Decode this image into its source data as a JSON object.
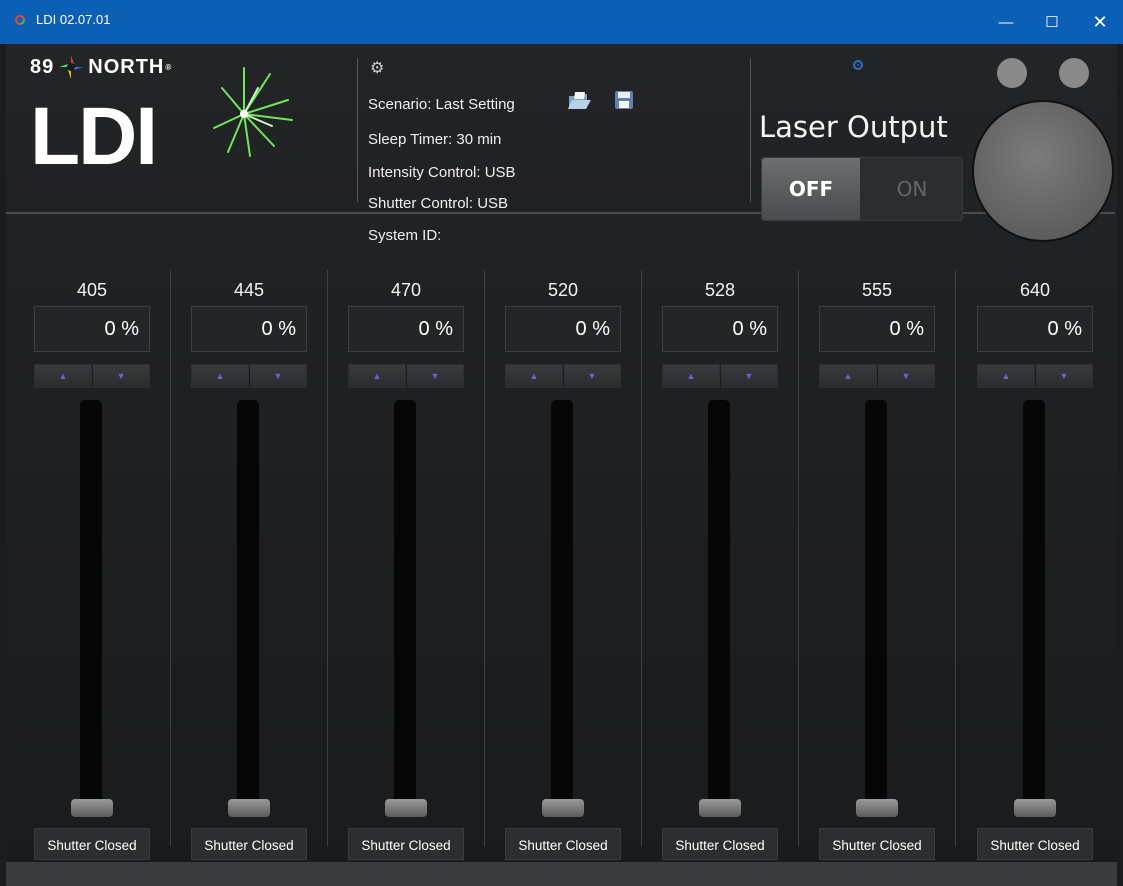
{
  "window": {
    "title": "LDI 02.07.01",
    "minimize_glyph": "—",
    "maximize_glyph": "☐",
    "close_glyph": "✕"
  },
  "logo": {
    "brand_top_left": "89",
    "brand_top_right": "NORTH",
    "trademark": "®",
    "product": "LDI"
  },
  "settings": {
    "gear_icon": "gear-icon",
    "scenario_label": "Scenario:",
    "scenario_value": "Last Setting",
    "sleep_timer": "Sleep Timer: 30 min",
    "intensity_control": "Intensity Control: USB",
    "shutter_control": "Shutter Control: USB",
    "system_id": "System ID:",
    "open_icon": "folder-open-icon",
    "save_icon": "save-disk-icon"
  },
  "laser": {
    "title": "Laser Output",
    "off_label": "OFF",
    "on_label": "ON",
    "state": "OFF"
  },
  "channels": [
    {
      "wavelength": "405",
      "intensity": "0 %",
      "shutter": "Shutter Closed",
      "level": 0
    },
    {
      "wavelength": "445",
      "intensity": "0 %",
      "shutter": "Shutter Closed",
      "level": 0
    },
    {
      "wavelength": "470",
      "intensity": "0 %",
      "shutter": "Shutter Closed",
      "level": 0
    },
    {
      "wavelength": "520",
      "intensity": "0 %",
      "shutter": "Shutter Closed",
      "level": 0
    },
    {
      "wavelength": "528",
      "intensity": "0 %",
      "shutter": "Shutter Closed",
      "level": 0
    },
    {
      "wavelength": "555",
      "intensity": "0 %",
      "shutter": "Shutter Closed",
      "level": 0
    },
    {
      "wavelength": "640",
      "intensity": "0 %",
      "shutter": "Shutter Closed",
      "level": 0
    }
  ],
  "colors": {
    "titlebar": "#0b5fb4",
    "background": "#1b1c1e",
    "accent_burst": "#6ee85a",
    "stepper_arrow": "#6b63d8"
  }
}
